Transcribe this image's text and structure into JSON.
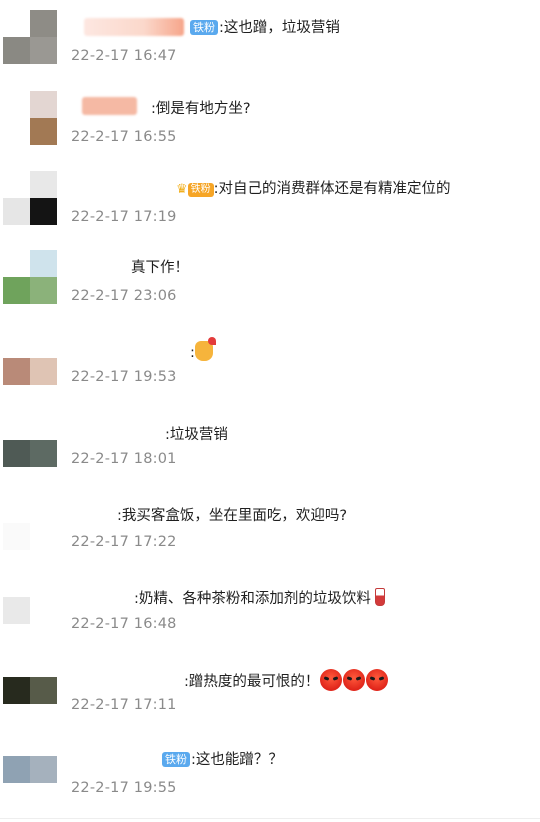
{
  "comments": [
    {
      "badge": "铁粉",
      "text": ":这也蹭，垃圾营销",
      "time": "22-2-17 16:47"
    },
    {
      "text": ":倒是有地方坐?",
      "time": "22-2-17 16:55"
    },
    {
      "badge": "铁粉",
      "text": ":对自己的消费群体还是有精准定位的",
      "time": "22-2-17 17:19"
    },
    {
      "text": "真下作！",
      "time": "22-2-17 23:06"
    },
    {
      "text": ":",
      "time": "22-2-17 19:53"
    },
    {
      "text": ":垃圾营销",
      "time": "22-2-17 18:01"
    },
    {
      "text": ":我买客盒饭，坐在里面吃，欢迎吗?",
      "time": "22-2-17 17:22"
    },
    {
      "text": ":奶精、各种茶粉和添加剂的垃圾饮料",
      "time": "22-2-17 16:48"
    },
    {
      "text": ":蹭热度的最可恨的！",
      "time": "22-2-17 17:11"
    },
    {
      "badge": "铁粉",
      "text": ":这也能蹭？？",
      "time": "22-2-17 19:55"
    }
  ],
  "icons": {
    "crown": "crown-icon",
    "hug": "hug-emoji",
    "angry": "angry-face-emoji",
    "drink": "drink-cup-emoji"
  },
  "colors": {
    "fan_badge": "#5aa9ee",
    "gold_badge": "#f6a526",
    "timestamp": "#8a8a8a"
  }
}
